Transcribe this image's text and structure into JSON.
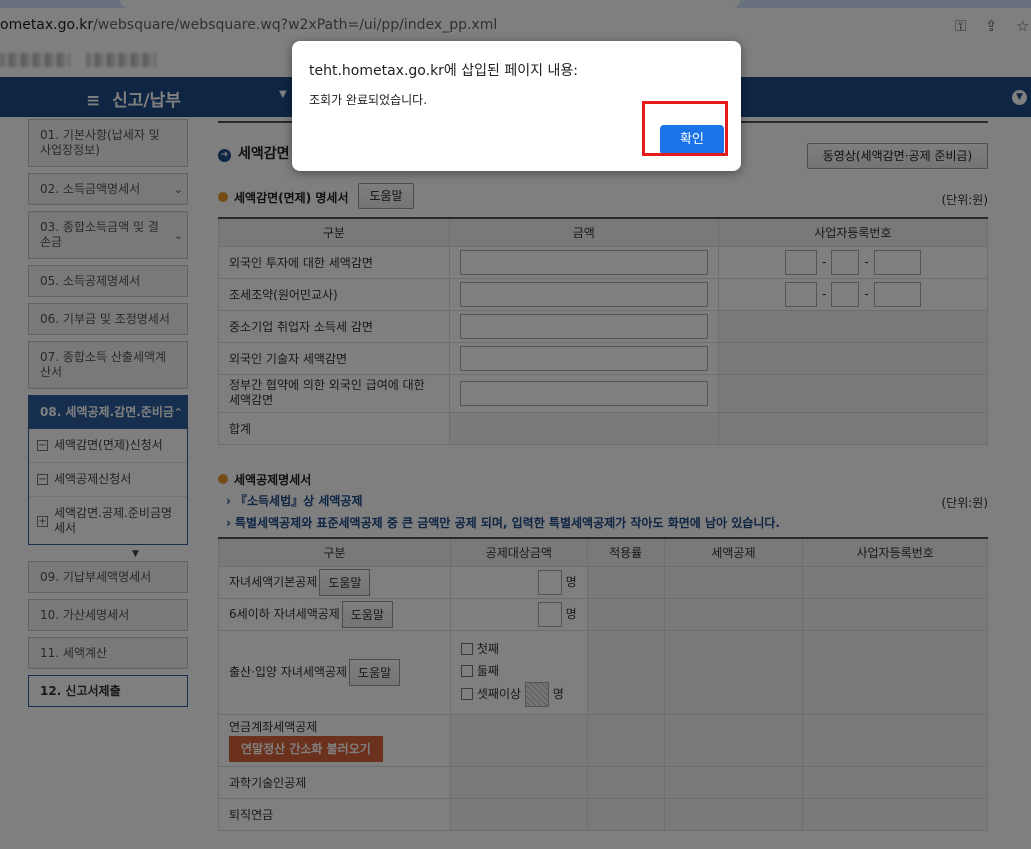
{
  "browser": {
    "url_host": "ometax.go.kr",
    "url_path": "/websquare/websquare.wq?w2xPath=/ui/pp/index_pp.xml"
  },
  "topnav": {
    "menu_glyph": "≡",
    "title": "신고/납부"
  },
  "sidebar": {
    "items": [
      {
        "label": "01. 기본사항(납세자 및 사업장정보)"
      },
      {
        "label": "02. 소득금액명세서"
      },
      {
        "label": "03. 종합소득금액 및 결손금"
      },
      {
        "label": "05. 소득공제명세서"
      },
      {
        "label": "06. 기부금 및 조정명세서"
      },
      {
        "label": "07. 종합소득 산출세액계산서"
      },
      {
        "label": "08. 세액공제.감면.준비금"
      },
      {
        "label": "09. 기납부세액명세서"
      },
      {
        "label": "10. 가산세명세서"
      },
      {
        "label": "11. 세액계산"
      },
      {
        "label": "12. 신고서제출"
      }
    ],
    "subitems": [
      {
        "box": "−",
        "label": "세액감면(면제)신청서"
      },
      {
        "box": "−",
        "label": "세액공제신청서"
      },
      {
        "box": "+",
        "label": "세액감면.공제.준비금명세서"
      }
    ]
  },
  "main": {
    "section_title": "세액감면",
    "video_button": "동영상(세액감면·공제 준비금)",
    "exemption": {
      "title": "세액감면(면제) 명세서",
      "help": "도움말",
      "unit": "(단위:원)",
      "headers": [
        "구분",
        "금액",
        "사업자등록번호"
      ],
      "rows": [
        {
          "label": "외국인 투자에 대한 세액감면"
        },
        {
          "label": "조세조약(원어민교사)"
        },
        {
          "label": "중소기업 취업자 소득세 감면"
        },
        {
          "label": "외국인 기술자 세액감면"
        },
        {
          "label": "정부간 협약에 의한 외국인 급여에 대한 세액감면"
        },
        {
          "label": "합계"
        }
      ]
    },
    "credit": {
      "title": "세액공제명세서",
      "note1": "『소득세법』상 세액공제",
      "note2": "특별세액공제와 표준세액공제 중 큰 금액만 공제 되며, 입력한 특별세액공제가 작아도 화면에 남아 있습니다.",
      "unit": "(단위:원)",
      "headers": [
        "구분",
        "공제대상금액",
        "적용률",
        "세액공제",
        "사업자등록번호"
      ],
      "count_unit": "명",
      "help": "도움말",
      "rows": [
        {
          "label": "자녀세액기본공제"
        },
        {
          "label": "6세이하 자녀세액공제"
        },
        {
          "label": "출산·입양 자녀세액공제"
        },
        {
          "label": "연금계좌세액공제"
        },
        {
          "label": "과학기술인공제"
        },
        {
          "label": "퇴직연금"
        }
      ],
      "birth_options": [
        "첫째",
        "둘째",
        "셋째이상"
      ],
      "pension_button": "연말정산 간소화 불러오기"
    }
  },
  "dialog": {
    "title": "teht.hometax.go.kr에 삽입된 페이지 내용:",
    "message": "조회가 완료되었습니다.",
    "ok": "확인"
  }
}
